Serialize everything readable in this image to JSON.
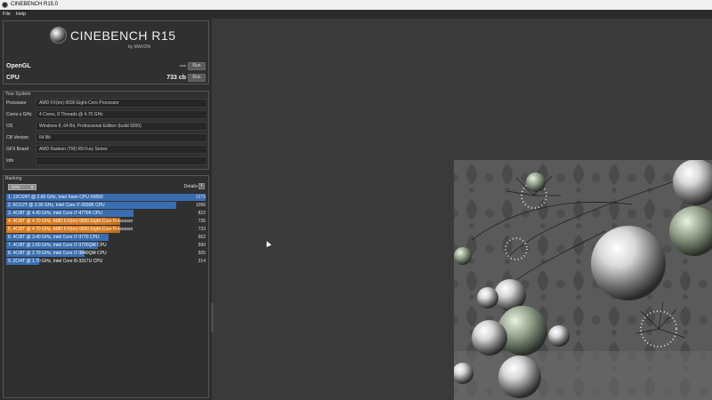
{
  "window": {
    "title": "CINEBENCH R15.0"
  },
  "menu": [
    "File",
    "Help"
  ],
  "logo": {
    "name": "CINEBENCH R15",
    "byline": "by MAXON"
  },
  "benchmarks": [
    {
      "label": "OpenGL",
      "score": "---",
      "button": "Run"
    },
    {
      "label": "CPU",
      "score": "733 cb",
      "button": "Run"
    }
  ],
  "system": {
    "title": "Your System",
    "rows": [
      {
        "key": "Processor",
        "value": "AMD FX(tm)-9590 Eight-Core Processor"
      },
      {
        "key": "Cores x GHz",
        "value": "4 Cores, 8 Threads @ 4.70 GHz"
      },
      {
        "key": "OS",
        "value": "Windows 8, 64 Bit, Professional Edition (build 9200)"
      },
      {
        "key": "CB Version",
        "value": "64 Bit"
      },
      {
        "key": "GFX Board",
        "value": "AMD Radeon (TM) R9 Fury Series"
      },
      {
        "key": "Info",
        "value": ""
      }
    ]
  },
  "ranking": {
    "title": "Ranking",
    "dropdown": "CPU",
    "details_label": "Details",
    "details_button": "+",
    "rows": [
      {
        "text": "1. 12C/24T @ 2.66 GHz, Intel Xeon CPU X5650",
        "score": "1279",
        "highlight": false
      },
      {
        "text": "2. 6C/12T @ 3.30 GHz,  Intel Core i7-3930K CPU",
        "score": "1096",
        "highlight": false
      },
      {
        "text": "3. 4C/8T @ 4.40 GHz, Intel Core i7-4770K CPU",
        "score": "822",
        "highlight": false
      },
      {
        "text": "4. 4C/8T @ 4.70 GHz, AMD FX(tm)-9590 Eight-Core Processor",
        "score": "735",
        "highlight": true
      },
      {
        "text": "5. 4C/8T @ 4.70 GHz, AMD FX(tm)-9590 Eight-Core Processor",
        "score": "733",
        "highlight": true
      },
      {
        "text": "6. 4C/8T @ 3.40 GHz, Intel Core i7-3770 CPU",
        "score": "662",
        "highlight": false
      },
      {
        "text": "7. 4C/8T @ 2.60 GHz, Intel Core i7-3720QM CPU",
        "score": "590",
        "highlight": false
      },
      {
        "text": "8. 4C/8T @ 2.79 GHz, Intel Core i7-3840QM CPU",
        "score": "505",
        "highlight": false
      },
      {
        "text": "9. 2C/4T @ 1.70 GHz,  Intel Core i5-3317U CPU",
        "score": "214",
        "highlight": false
      }
    ]
  },
  "colors": {
    "bar_blue": "#3a6db0",
    "bar_orange": "#d97a1e",
    "bar_orange_tail": "#b96a1a"
  }
}
